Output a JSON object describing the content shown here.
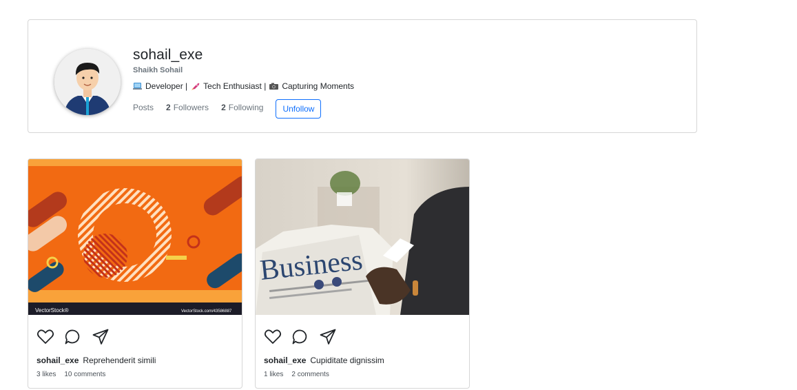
{
  "profile": {
    "username": "sohail_exe",
    "full_name": "Shaikh Sohail",
    "bio": {
      "part1": "Developer |",
      "part2": "Tech Enthusiast |",
      "part3": "Capturing Moments",
      "icons": [
        "laptop-emoji",
        "rocket-emoji",
        "camera-emoji"
      ]
    },
    "posts_label": "Posts",
    "followers_count": "2",
    "followers_label": "Followers",
    "following_count": "2",
    "following_label": "Following",
    "unfollow_label": "Unfollow",
    "accent_color": "#0d6efd"
  },
  "posts": [
    {
      "image_watermark_left": "VectorStock®",
      "image_watermark_right": "VectorStock.com/43586887",
      "username": "sohail_exe",
      "caption": "Reprehenderit simili",
      "likes": "3 likes",
      "comments": "10 comments"
    },
    {
      "image_headline": "Business",
      "username": "sohail_exe",
      "caption": "Cupiditate dignissim",
      "likes": "1 likes",
      "comments": "2 comments"
    }
  ],
  "icons": {
    "like": "heart-icon",
    "comment": "comment-icon",
    "share": "send-icon"
  }
}
